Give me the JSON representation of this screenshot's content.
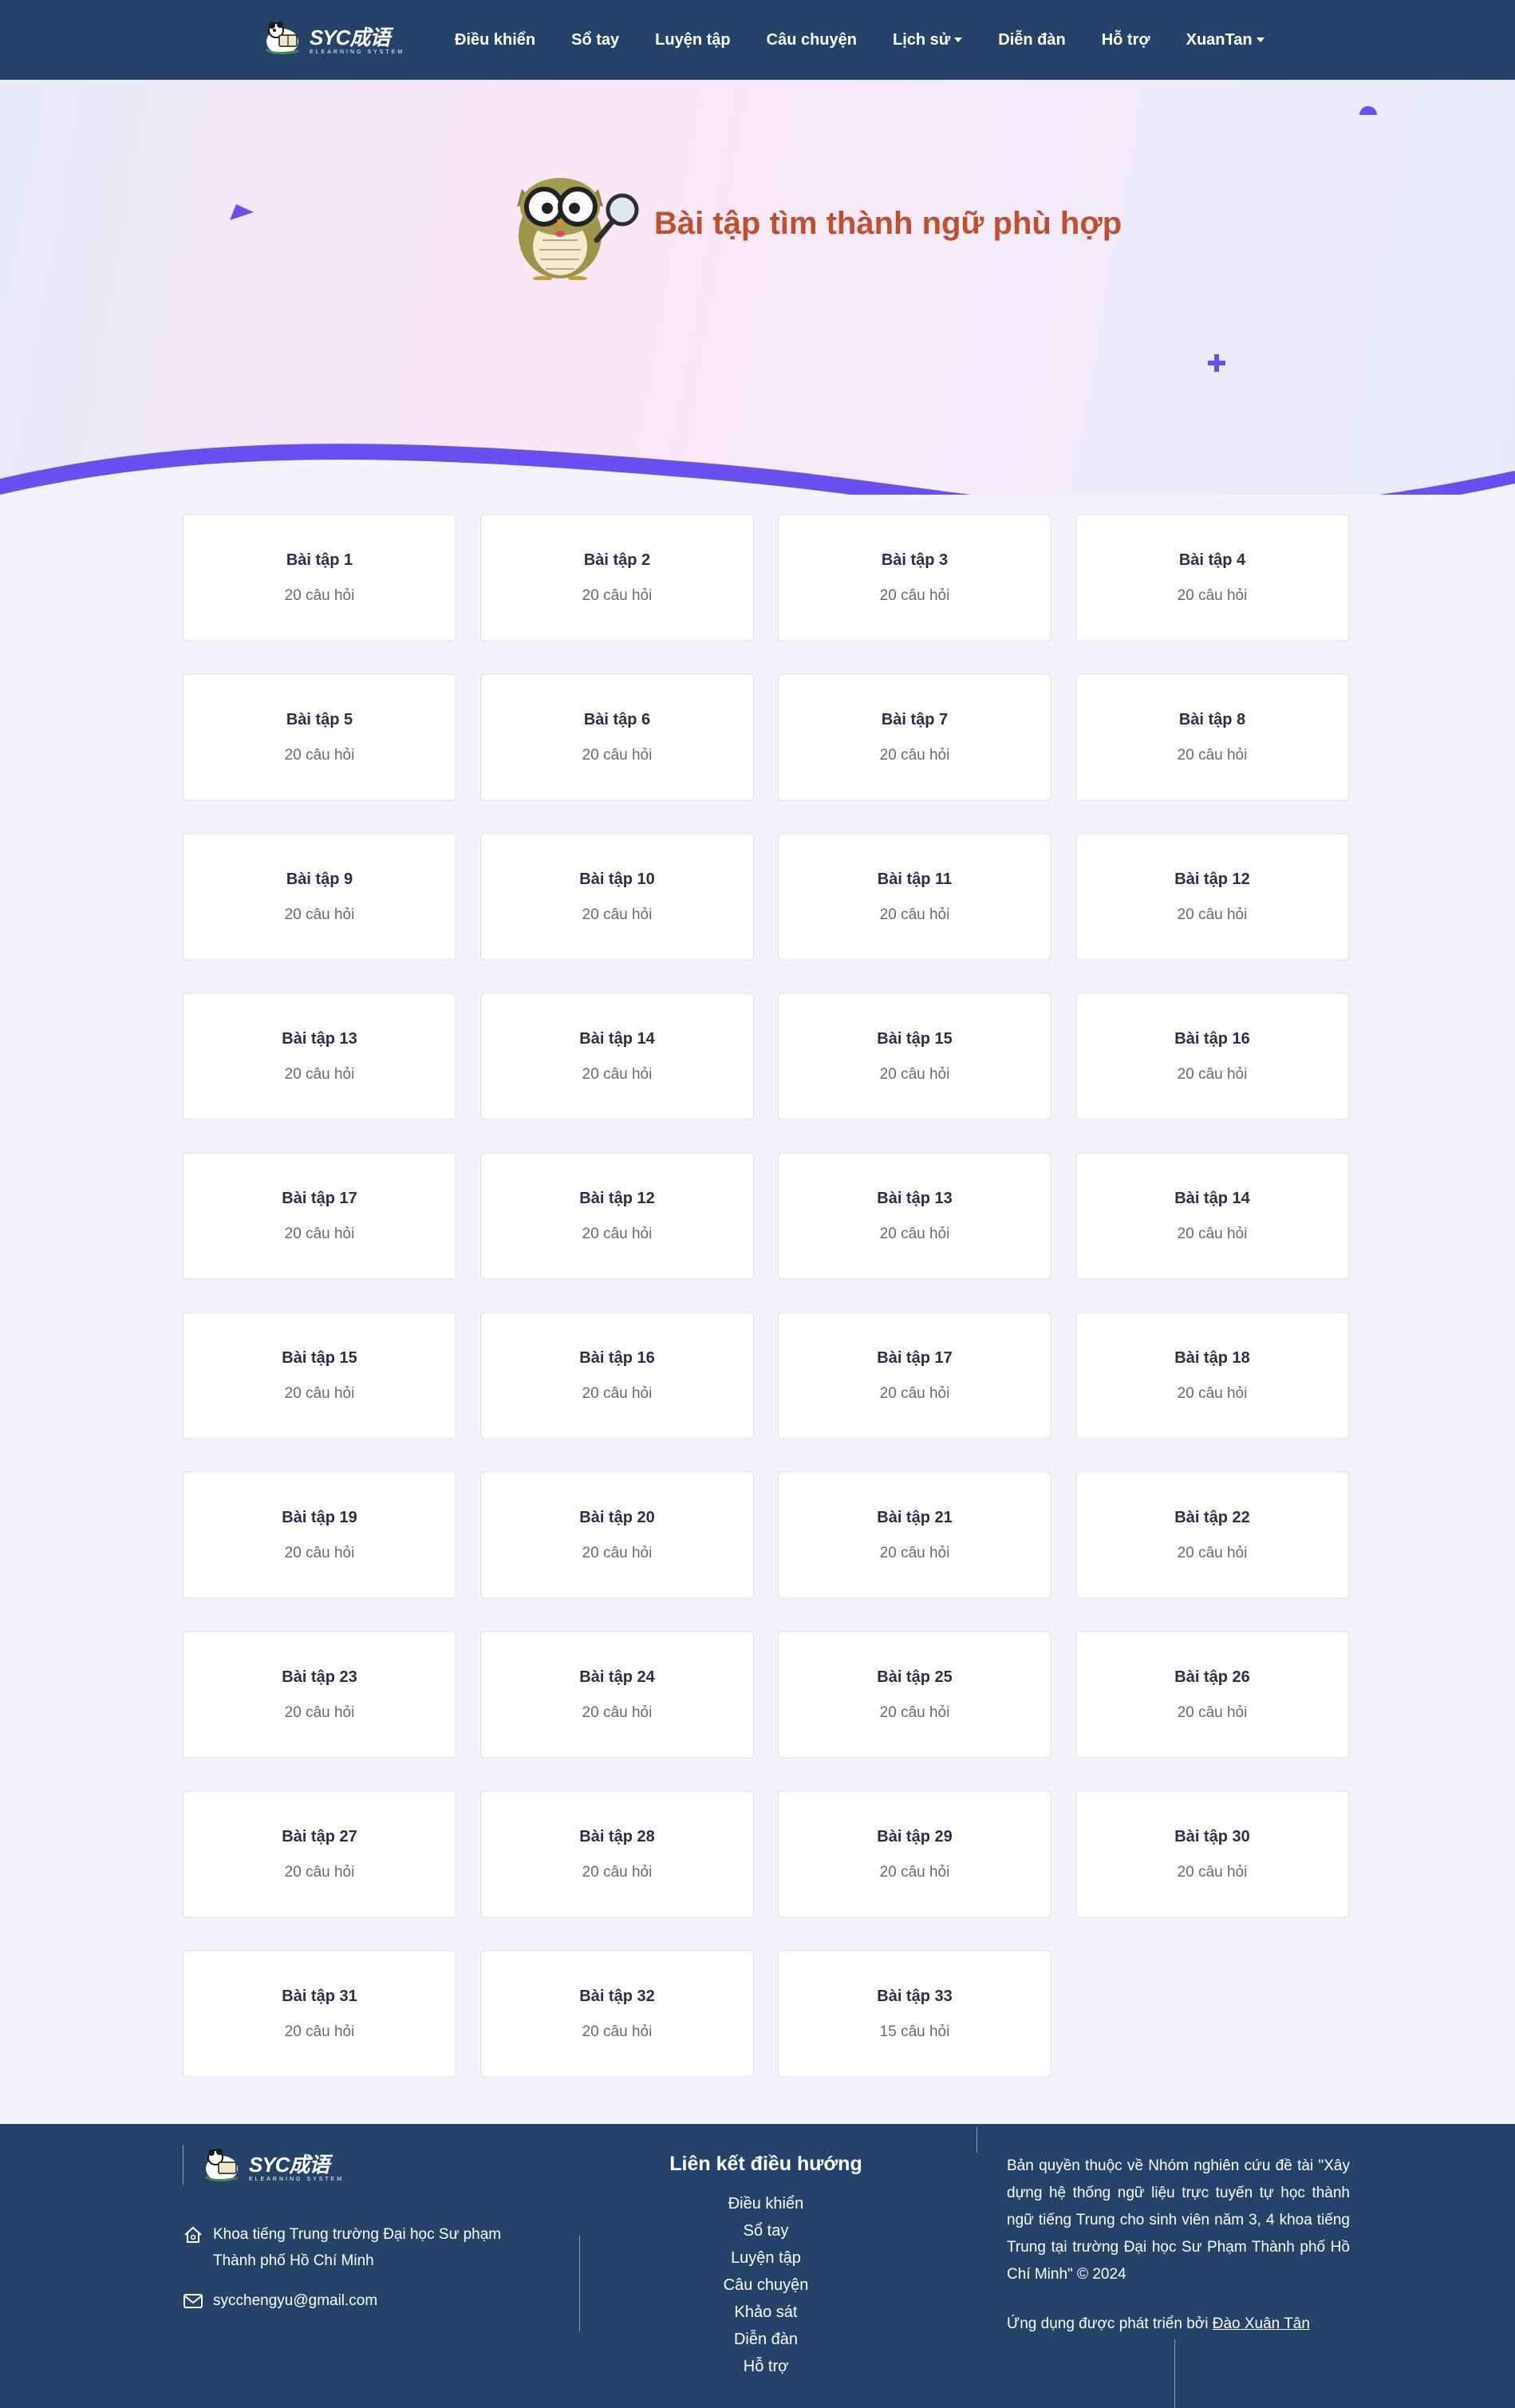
{
  "nav": {
    "brand_text": "SYC成语",
    "brand_sub": "ELEARNING SYSTEM",
    "links": [
      "Điều khiển",
      "Sổ tay",
      "Luyện tập",
      "Câu chuyện",
      "Lịch sử",
      "Diễn đàn",
      "Hỗ trợ",
      "XuanTan"
    ],
    "dropdowns": [
      "Lịch sử",
      "XuanTan"
    ]
  },
  "hero": {
    "title": "Bài tập tìm thành ngữ phù hợp",
    "mascot_icon": "owl-with-magnifier-icon"
  },
  "colors": {
    "navbar": "#25426a",
    "accent": "#6a4ff0",
    "hero_title": "#c24e2c"
  },
  "exercises": [
    {
      "title": "Bài tập 1",
      "questions": "20 câu hỏi"
    },
    {
      "title": "Bài tập 2",
      "questions": "20 câu hỏi"
    },
    {
      "title": "Bài tập 3",
      "questions": "20 câu hỏi"
    },
    {
      "title": "Bài tập 4",
      "questions": "20 câu hỏi"
    },
    {
      "title": "Bài tập 5",
      "questions": "20 câu hỏi"
    },
    {
      "title": "Bài tập 6",
      "questions": "20 câu hỏi"
    },
    {
      "title": "Bài tập 7",
      "questions": "20 câu hỏi"
    },
    {
      "title": "Bài tập 8",
      "questions": "20 câu hỏi"
    },
    {
      "title": "Bài tập 9",
      "questions": "20 câu hỏi"
    },
    {
      "title": "Bài tập 10",
      "questions": "20 câu hỏi"
    },
    {
      "title": "Bài tập 11",
      "questions": "20 câu hỏi"
    },
    {
      "title": "Bài tập 12",
      "questions": "20 câu hỏi"
    },
    {
      "title": "Bài tập 13",
      "questions": "20 câu hỏi"
    },
    {
      "title": "Bài tập 14",
      "questions": "20 câu hỏi"
    },
    {
      "title": "Bài tập 15",
      "questions": "20 câu hỏi"
    },
    {
      "title": "Bài tập 16",
      "questions": "20 câu hỏi"
    },
    {
      "title": "Bài tập 17",
      "questions": "20 câu hỏi"
    },
    {
      "title": "Bài tập 12",
      "questions": "20 câu hỏi"
    },
    {
      "title": "Bài tập 13",
      "questions": "20 câu hỏi"
    },
    {
      "title": "Bài tập 14",
      "questions": "20 câu hỏi"
    },
    {
      "title": "Bài tập 15",
      "questions": "20 câu hỏi"
    },
    {
      "title": "Bài tập 16",
      "questions": "20 câu hỏi"
    },
    {
      "title": "Bài tập 17",
      "questions": "20 câu hỏi"
    },
    {
      "title": "Bài tập 18",
      "questions": "20 câu hỏi"
    },
    {
      "title": "Bài tập 19",
      "questions": "20 câu hỏi"
    },
    {
      "title": "Bài tập 20",
      "questions": "20 câu hỏi"
    },
    {
      "title": "Bài tập 21",
      "questions": "20 câu hỏi"
    },
    {
      "title": "Bài tập 22",
      "questions": "20 câu hỏi"
    },
    {
      "title": "Bài tập 23",
      "questions": "20 câu hỏi"
    },
    {
      "title": "Bài tập 24",
      "questions": "20 câu hỏi"
    },
    {
      "title": "Bài tập 25",
      "questions": "20 câu hỏi"
    },
    {
      "title": "Bài tập 26",
      "questions": "20 câu hỏi"
    },
    {
      "title": "Bài tập 27",
      "questions": "20 câu hỏi"
    },
    {
      "title": "Bài tập 28",
      "questions": "20 câu hỏi"
    },
    {
      "title": "Bài tập 29",
      "questions": "20 câu hỏi"
    },
    {
      "title": "Bài tập 30",
      "questions": "20 câu hỏi"
    },
    {
      "title": "Bài tập 31",
      "questions": "20 câu hỏi"
    },
    {
      "title": "Bài tập 32",
      "questions": "20 câu hỏi"
    },
    {
      "title": "Bài tập 33",
      "questions": "15 câu hỏi"
    }
  ],
  "footer": {
    "brand_text": "SYC成语",
    "brand_sub": "ELEARNING SYSTEM",
    "address_line1": "Khoa tiếng Trung trường Đại học Sư phạm",
    "address_line2": "Thành phố Hồ Chí Minh",
    "email": "sycchengyu@gmail.com",
    "nav_title": "Liên kết điều hướng",
    "nav_links": [
      "Điều khiển",
      "Sổ tay",
      "Luyện tập",
      "Câu chuyện",
      "Khảo sát",
      "Diễn đàn",
      "Hỗ trợ"
    ],
    "copyright": "Bản quyền thuộc về Nhóm nghiên cứu đề tài \"Xây dựng hệ thống ngữ liệu trực tuyến tự học thành ngữ tiếng Trung cho sinh viên năm 3, 4 khoa tiếng Trung tại trường Đại học Sư Phạm Thành phố Hồ Chí Minh\" © 2024",
    "developer_prefix": "Ứng dụng được phát triển bởi ",
    "developer_name": "Đào Xuân Tân"
  }
}
